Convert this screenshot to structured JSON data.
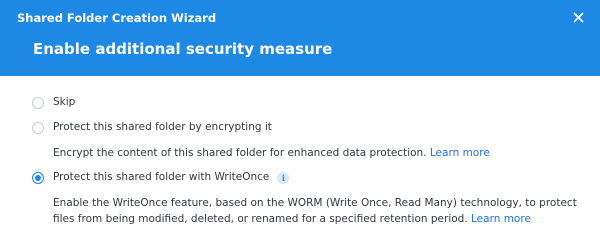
{
  "window": {
    "title": "Shared Folder Creation Wizard",
    "close_icon": "close-icon"
  },
  "step": {
    "title": "Enable additional security measure"
  },
  "options": [
    {
      "label": "Skip",
      "selected": false
    },
    {
      "label": "Protect this shared folder by encrypting it",
      "selected": false,
      "description": "Encrypt the content of this shared folder for enhanced data protection.",
      "link_text": "Learn more"
    },
    {
      "label": "Protect this shared folder with WriteOnce",
      "selected": true,
      "info_icon": "info-icon",
      "description": "Enable the WriteOnce feature, based on the WORM (Write Once, Read Many) technology, to protect files from being modified, deleted, or renamed for a specified retention period.",
      "link_text": "Learn more"
    }
  ],
  "colors": {
    "header_bg": "#1e88e5",
    "accent": "#1e88e5",
    "link": "#1e72d6",
    "text": "#303845"
  }
}
